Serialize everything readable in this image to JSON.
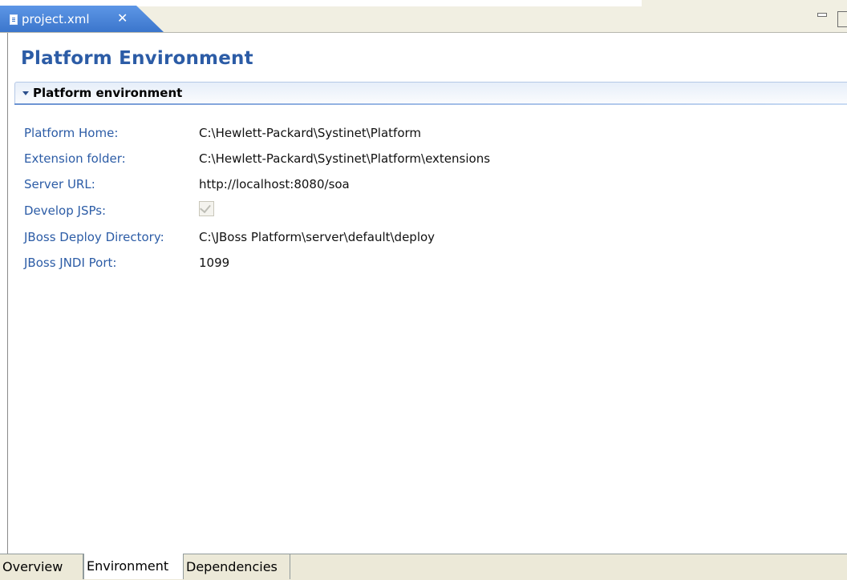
{
  "editor": {
    "tab_title": "project.xml",
    "tab_icon": "file-icon",
    "close_glyph": "✕"
  },
  "page": {
    "title": "Platform Environment"
  },
  "section": {
    "title": "Platform environment",
    "expanded": true
  },
  "fields": [
    {
      "label": "Platform Home:",
      "value": "C:\\Hewlett-Packard\\Systinet\\Platform"
    },
    {
      "label": "Extension folder:",
      "value": "C:\\Hewlett-Packard\\Systinet\\Platform\\extensions"
    },
    {
      "label": "Server URL:",
      "value": "http://localhost:8080/soa"
    },
    {
      "label": "Develop JSPs:",
      "checked": true
    },
    {
      "label": "JBoss Deploy Directory:",
      "value": "C:\\JBoss Platform\\server\\default\\deploy"
    },
    {
      "label": "JBoss JNDI Port:",
      "value": "1099"
    }
  ],
  "page_tabs": [
    {
      "label": "Overview",
      "active": false
    },
    {
      "label": "Environment",
      "active": true
    },
    {
      "label": "Dependencies",
      "active": false
    }
  ],
  "colors": {
    "tab_blue": "#3b76cc",
    "title_blue": "#2c5ca6",
    "label_blue": "#2c5ca6"
  }
}
